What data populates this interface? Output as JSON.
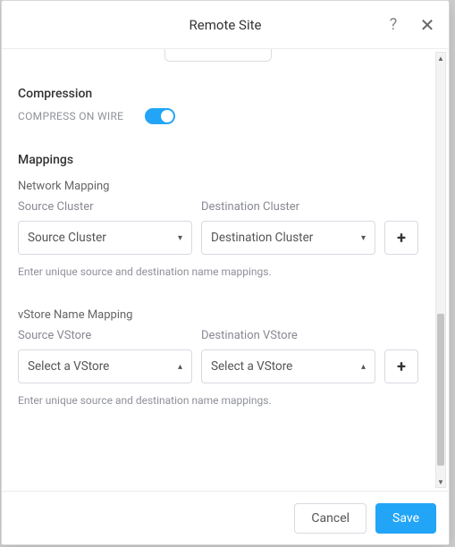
{
  "header": {
    "title": "Remote Site"
  },
  "compression": {
    "section": "Compression",
    "toggleLabel": "COMPRESS ON WIRE",
    "toggleOn": true
  },
  "mappings": {
    "section": "Mappings",
    "network": {
      "title": "Network Mapping",
      "sourceLabel": "Source Cluster",
      "destLabel": "Destination Cluster",
      "sourceValue": "Source Cluster",
      "destValue": "Destination Cluster",
      "hint": "Enter unique source and destination name mappings."
    },
    "vstore": {
      "title": "vStore Name Mapping",
      "sourceLabel": "Source VStore",
      "destLabel": "Destination VStore",
      "sourceValue": "Select a VStore",
      "destValue": "Select a VStore",
      "hint": "Enter unique source and destination name mappings."
    }
  },
  "footer": {
    "cancel": "Cancel",
    "save": "Save"
  }
}
